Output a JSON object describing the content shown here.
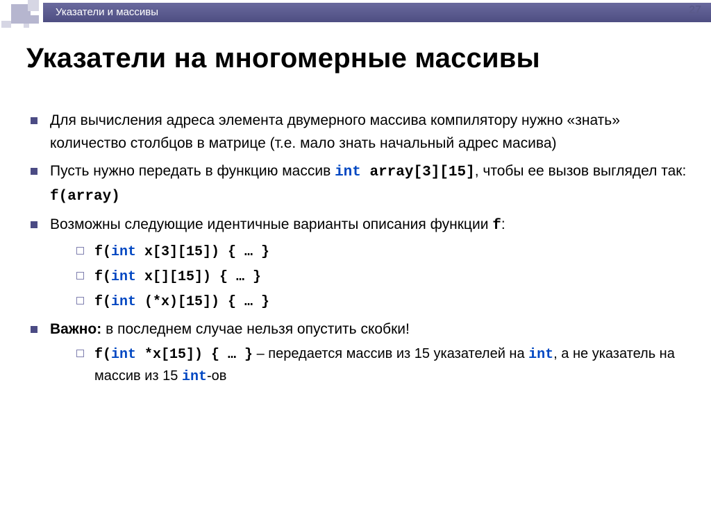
{
  "header": {
    "section": "Указатели и массивы",
    "page": "27"
  },
  "title": "Указатели на многомерные массивы",
  "bullets": [
    {
      "segments": [
        {
          "t": "Для вычисления адреса элемента двумерного массива компилятору нужно «знать» количество столбцов в матрице (т.е. мало знать начальный адрес масива)"
        }
      ]
    },
    {
      "segments": [
        {
          "t": "Пусть нужно передать в функцию массив "
        },
        {
          "t": "int",
          "code": true,
          "kw": true
        },
        {
          "t": " array[3][15]",
          "code": true
        },
        {
          "t": ", чтобы ее вызов выглядел так: "
        },
        {
          "t": "f(array)",
          "code": true
        }
      ]
    },
    {
      "segments": [
        {
          "t": "Возможны следующие идентичные  варианты описания функции "
        },
        {
          "t": "f",
          "code": true
        },
        {
          "t": ":"
        }
      ],
      "sub": [
        {
          "segments": [
            {
              "t": "f(",
              "code": true
            },
            {
              "t": "int",
              "code": true,
              "kw": true
            },
            {
              "t": " x[3][15]) { … }",
              "code": true
            }
          ]
        },
        {
          "segments": [
            {
              "t": "f(",
              "code": true
            },
            {
              "t": "int",
              "code": true,
              "kw": true
            },
            {
              "t": " x[][15]) { … }",
              "code": true
            }
          ]
        },
        {
          "segments": [
            {
              "t": "f(",
              "code": true
            },
            {
              "t": "int",
              "code": true,
              "kw": true
            },
            {
              "t": " (*x)[15]) { … }",
              "code": true
            }
          ]
        }
      ]
    },
    {
      "segments": [
        {
          "t": "Важно:",
          "bold": true
        },
        {
          "t": " в последнем случае нельзя опустить скобки!"
        }
      ],
      "sub": [
        {
          "segments": [
            {
              "t": "f(",
              "code": true
            },
            {
              "t": "int",
              "code": true,
              "kw": true
            },
            {
              "t": " *x[15]) { … }",
              "code": true
            },
            {
              "t": " – передается массив из 15 указателей на "
            },
            {
              "t": "int",
              "code": true,
              "kw": true
            },
            {
              "t": ", а не указатель на массив из 15 "
            },
            {
              "t": "int",
              "code": true,
              "kw": true
            },
            {
              "t": "-ов"
            }
          ]
        }
      ]
    }
  ]
}
